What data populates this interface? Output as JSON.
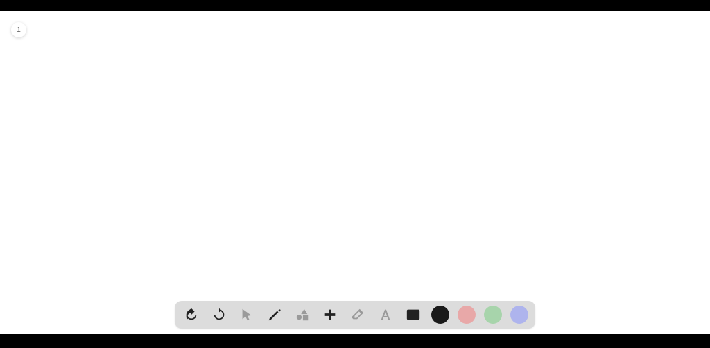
{
  "page": {
    "number": "1"
  },
  "toolbar": {
    "tools": {
      "undo": "undo",
      "redo": "redo",
      "select": "select",
      "pencil": "pencil",
      "shapes": "shapes",
      "plus": "plus",
      "eraser": "eraser",
      "text": "text",
      "image": "image"
    },
    "colors": {
      "black": "#1a1a1a",
      "red": "#e8a8a8",
      "green": "#a7d4ab",
      "blue": "#aeb4ed"
    }
  }
}
